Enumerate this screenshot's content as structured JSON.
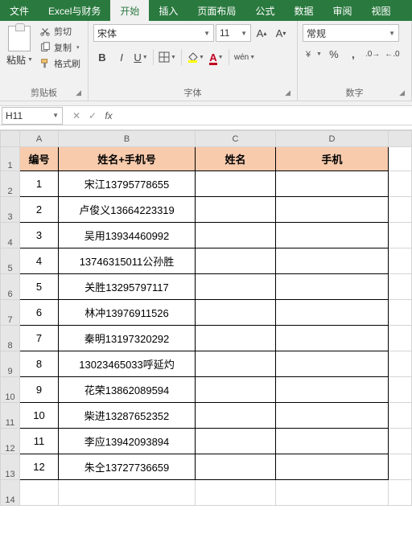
{
  "tabs": {
    "file": "文件",
    "custom": "Excel与财务",
    "home": "开始",
    "insert": "插入",
    "layout": "页面布局",
    "formulas": "公式",
    "data": "数据",
    "review": "审阅",
    "view": "视图",
    "active": "home"
  },
  "ribbon": {
    "clipboard": {
      "paste": "粘贴",
      "cut": "剪切",
      "copy": "复制",
      "format_painter": "格式刷",
      "group_label": "剪贴板"
    },
    "font": {
      "name": "宋体",
      "size": "11",
      "group_label": "字体"
    },
    "number": {
      "format": "常规",
      "group_label": "数字"
    }
  },
  "namebox": {
    "value": "H11"
  },
  "formula": {
    "value": ""
  },
  "columns": [
    "A",
    "B",
    "C",
    "D"
  ],
  "headers": {
    "a": "编号",
    "b": "姓名+手机号",
    "c": "姓名",
    "d": "手机"
  },
  "rows": [
    {
      "n": "1",
      "a": "1",
      "b": "宋江13795778655",
      "c": "",
      "d": ""
    },
    {
      "n": "2",
      "a": "2",
      "b": "卢俊义13664223319",
      "c": "",
      "d": ""
    },
    {
      "n": "3",
      "a": "3",
      "b": "吴用13934460992",
      "c": "",
      "d": ""
    },
    {
      "n": "4",
      "a": "4",
      "b": "13746315011公孙胜",
      "c": "",
      "d": ""
    },
    {
      "n": "5",
      "a": "5",
      "b": "关胜13295797117",
      "c": "",
      "d": ""
    },
    {
      "n": "6",
      "a": "6",
      "b": "林冲13976911526",
      "c": "",
      "d": ""
    },
    {
      "n": "7",
      "a": "7",
      "b": "秦明13197320292",
      "c": "",
      "d": ""
    },
    {
      "n": "8",
      "a": "8",
      "b": "13023465033呼延灼",
      "c": "",
      "d": ""
    },
    {
      "n": "9",
      "a": "9",
      "b": "花荣13862089594",
      "c": "",
      "d": ""
    },
    {
      "n": "10",
      "a": "10",
      "b": "柴进13287652352",
      "c": "",
      "d": ""
    },
    {
      "n": "11",
      "a": "11",
      "b": "李应13942093894",
      "c": "",
      "d": ""
    },
    {
      "n": "12",
      "a": "12",
      "b": "朱仝13727736659",
      "c": "",
      "d": ""
    }
  ],
  "blank_row_label": "14"
}
